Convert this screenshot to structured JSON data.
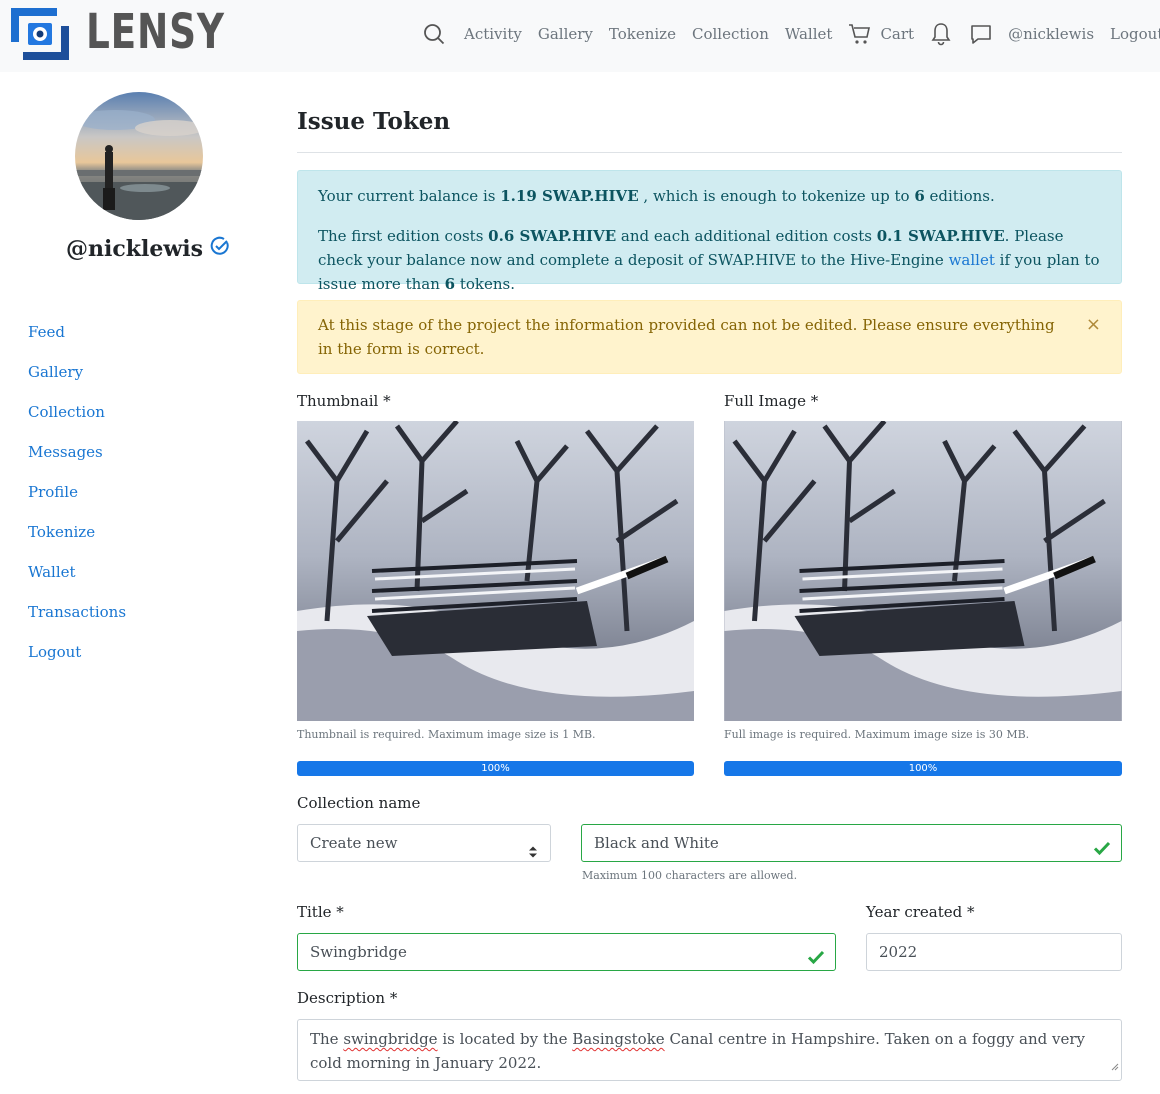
{
  "brand": {
    "name": "LENSY"
  },
  "nav": {
    "activity": "Activity",
    "gallery": "Gallery",
    "tokenize": "Tokenize",
    "collection": "Collection",
    "wallet": "Wallet",
    "cart": "Cart",
    "user": "@nicklewis",
    "logout": "Logout"
  },
  "profile": {
    "username": "@nicklewis"
  },
  "sidebar": {
    "items": [
      {
        "label": "Feed"
      },
      {
        "label": "Gallery"
      },
      {
        "label": "Collection"
      },
      {
        "label": "Messages"
      },
      {
        "label": "Profile"
      },
      {
        "label": "Tokenize"
      },
      {
        "label": "Wallet"
      },
      {
        "label": "Transactions"
      },
      {
        "label": "Logout"
      }
    ]
  },
  "page": {
    "title": "Issue Token"
  },
  "info": {
    "p1_a": "Your current balance is ",
    "balance": "1.19 SWAP.HIVE",
    "p1_b": " , which is enough to tokenize up to ",
    "editions": "6",
    "p1_c": " editions.",
    "p2_a": "The first edition costs ",
    "first_cost": "0.6 SWAP.HIVE",
    "p2_b": " and each additional edition costs ",
    "add_cost": "0.1 SWAP.HIVE",
    "p2_c": ". Please check your balance now and complete a deposit of SWAP.HIVE to the Hive-Engine ",
    "wallet_link": "wallet",
    "p2_d": " if you plan to issue more than ",
    "max_tokens": "6",
    "p2_e": " tokens."
  },
  "warning": {
    "text": "At this stage of the project the information provided can not be edited. Please ensure everything in the form is correct.",
    "close": "×"
  },
  "thumbnail": {
    "label": "Thumbnail *",
    "hint": "Thumbnail is required. Maximum image size is 1 MB.",
    "progress_text": "100%",
    "progress": 1.0
  },
  "full_image": {
    "label": "Full Image *",
    "hint": "Full image is required. Maximum image size is 30 MB.",
    "progress_text": "100%",
    "progress": 1.0
  },
  "collection": {
    "label": "Collection name",
    "select_value": "Create new",
    "name_value": "Black and White",
    "hint": "Maximum 100 characters are allowed."
  },
  "title_field": {
    "label": "Title *",
    "value": "Swingbridge"
  },
  "year_field": {
    "label": "Year created *",
    "value": "2022"
  },
  "description": {
    "label": "Description *",
    "t1": "The ",
    "w1": "swingbridge",
    "t2": " is located by the ",
    "w2": "Basingstoke",
    "t3": " Canal centre in Hampshire. Taken on a foggy and very cold morning in January 2022."
  },
  "colors": {
    "accent": "#1976d2",
    "progress": "#1677e8",
    "valid": "#28a745",
    "info_bg": "#d1ecf1",
    "warn_bg": "#fff3cd"
  }
}
